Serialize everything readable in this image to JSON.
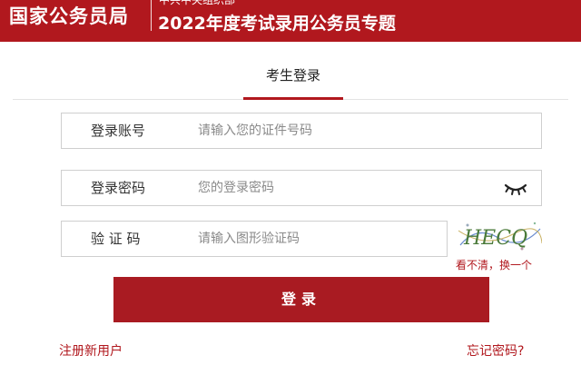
{
  "header": {
    "brand": "国家公务员局",
    "sub_org": "中共中央组织部",
    "special_title": "2022年度考试录用公务员专题"
  },
  "tab": {
    "label": "考生登录"
  },
  "form": {
    "account": {
      "label": "登录账号",
      "placeholder": "请输入您的证件号码"
    },
    "password": {
      "label": "登录密码",
      "placeholder": "您的登录密码"
    },
    "captcha": {
      "label": "验 证 码",
      "placeholder": "请输入图形验证码",
      "image_text": "HECQ",
      "refresh_text": "看不清，换一个"
    }
  },
  "login_button": "登录",
  "links": {
    "register": "注册新用户",
    "forgot": "忘记密码?"
  },
  "colors": {
    "brand_red": "#b1181e",
    "button_red": "#a91b22"
  }
}
